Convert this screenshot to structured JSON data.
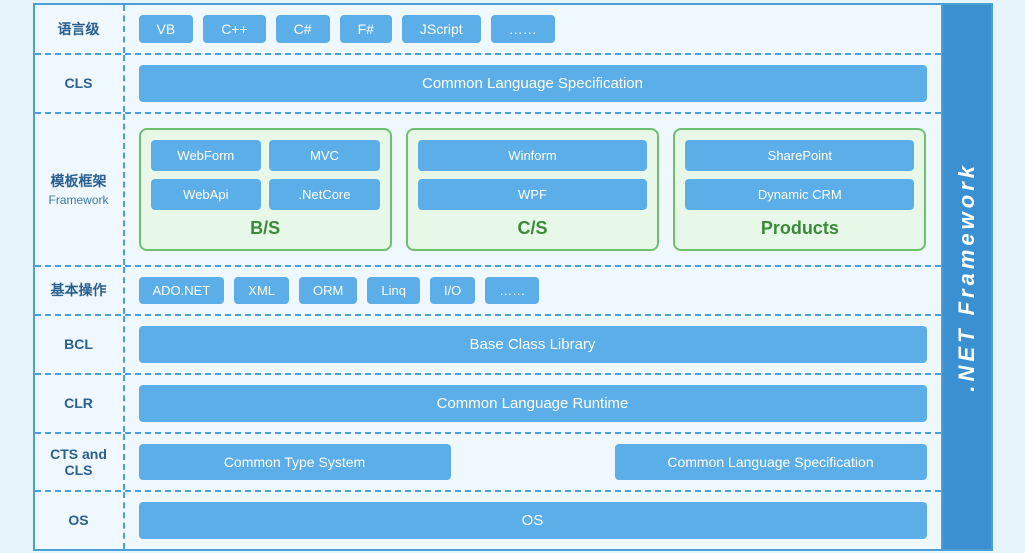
{
  "sidebar": {
    "title": ".NET Framework"
  },
  "rows": {
    "language": {
      "label": "语言级",
      "items": [
        "VB",
        "C++",
        "C#",
        "F#",
        "JScript",
        "……"
      ]
    },
    "cls": {
      "label": "CLS",
      "bar": "Common Language Specification"
    },
    "framework": {
      "label": "模板框架",
      "sublabel": "Framework",
      "groups": [
        {
          "id": "bs",
          "items": [
            [
              "WebForm",
              "MVC"
            ],
            [
              "WebApi",
              ".NetCore"
            ]
          ],
          "label": "B/S"
        },
        {
          "id": "cs",
          "items_top": "Winform",
          "items_bottom": "WPF",
          "label": "C/S"
        },
        {
          "id": "products",
          "items_top": "SharePoint",
          "items_bottom": "Dynamic CRM",
          "label": "Products"
        }
      ]
    },
    "basicops": {
      "label": "基本操作",
      "items": [
        "ADO.NET",
        "XML",
        "ORM",
        "Linq",
        "I/O",
        "……"
      ]
    },
    "bcl": {
      "label": "BCL",
      "bar": "Base Class Library"
    },
    "clr": {
      "label": "CLR",
      "bar": "Common Language Runtime"
    },
    "cts": {
      "label": "CTS and CLS",
      "left": "Common Type System",
      "right": "Common Language Specification"
    },
    "os": {
      "label": "OS",
      "bar": "OS"
    }
  }
}
